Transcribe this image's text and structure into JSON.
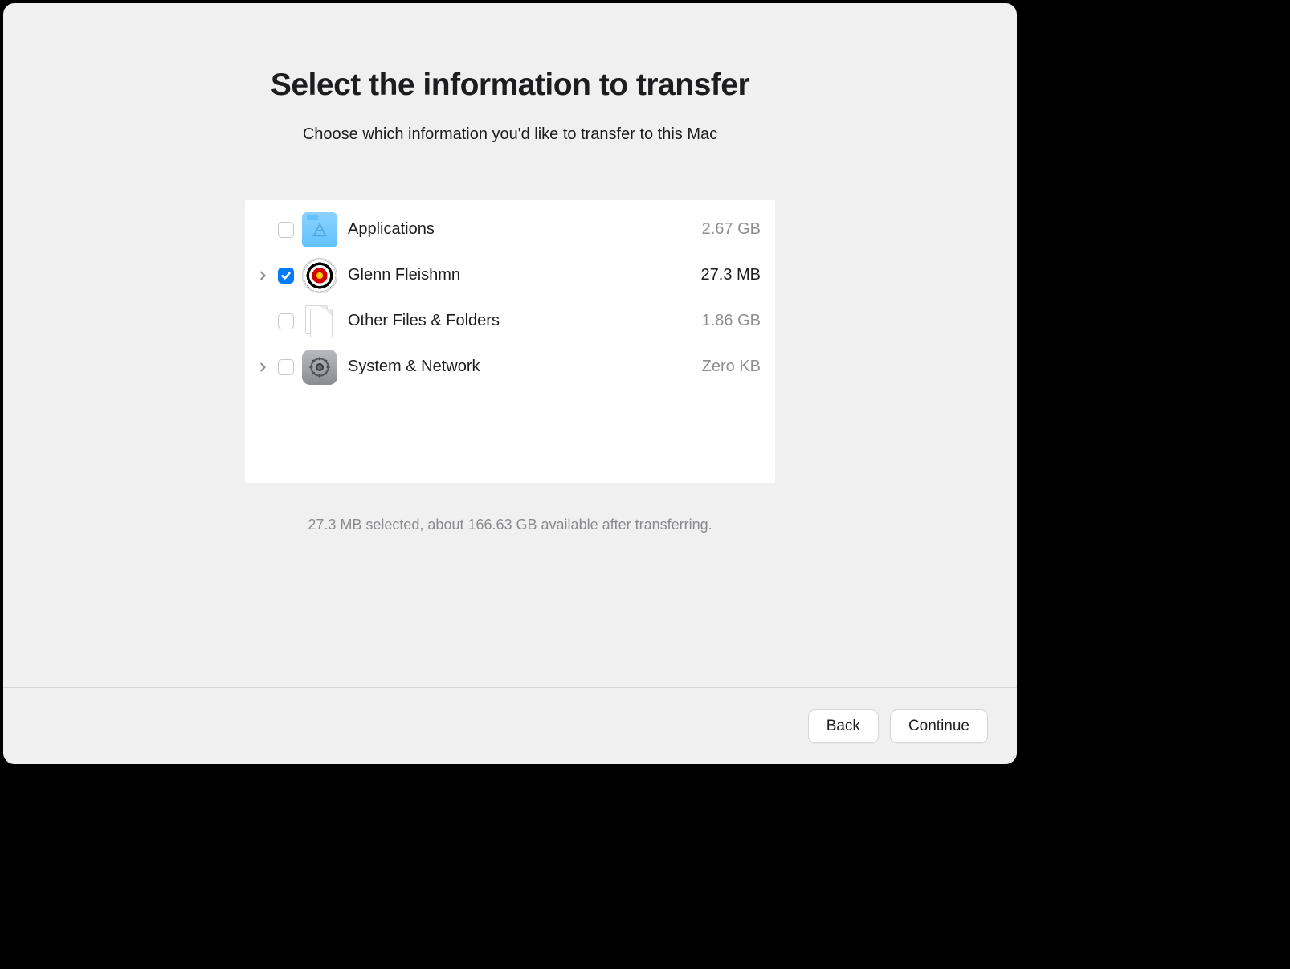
{
  "header": {
    "title": "Select the information to transfer",
    "subtitle": "Choose which information you'd like to transfer to this Mac"
  },
  "items": [
    {
      "label": "Applications",
      "size": "2.67 GB",
      "checked": false,
      "expandable": false,
      "icon": "applications"
    },
    {
      "label": "Glenn Fleishmn",
      "size": "27.3 MB",
      "checked": true,
      "expandable": true,
      "icon": "user"
    },
    {
      "label": "Other Files & Folders",
      "size": "1.86 GB",
      "checked": false,
      "expandable": false,
      "icon": "documents"
    },
    {
      "label": "System & Network",
      "size": "Zero KB",
      "checked": false,
      "expandable": true,
      "icon": "settings"
    }
  ],
  "status": "27.3 MB selected, about 166.63 GB available after transferring.",
  "buttons": {
    "back": "Back",
    "continue": "Continue"
  }
}
